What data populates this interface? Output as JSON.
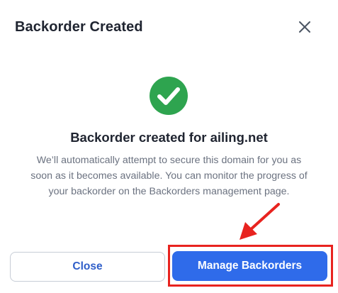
{
  "dialog": {
    "title": "Backorder Created",
    "close_icon": "close-icon"
  },
  "content": {
    "status_icon": "check-circle-icon",
    "heading": "Backorder created for ailing.net",
    "message": "We’ll automatically attempt to secure this domain for you as soon as it becomes available. You can monitor the progress of your backorder on the Backorders management page."
  },
  "footer": {
    "close_label": "Close",
    "manage_label": "Manage Backorders"
  },
  "annotation": {
    "arrow_icon": "red-arrow-icon",
    "highlight_color": "#e8231f"
  },
  "colors": {
    "success": "#2ea44f",
    "primary": "#2f6bea",
    "link": "#2f5ec9"
  }
}
